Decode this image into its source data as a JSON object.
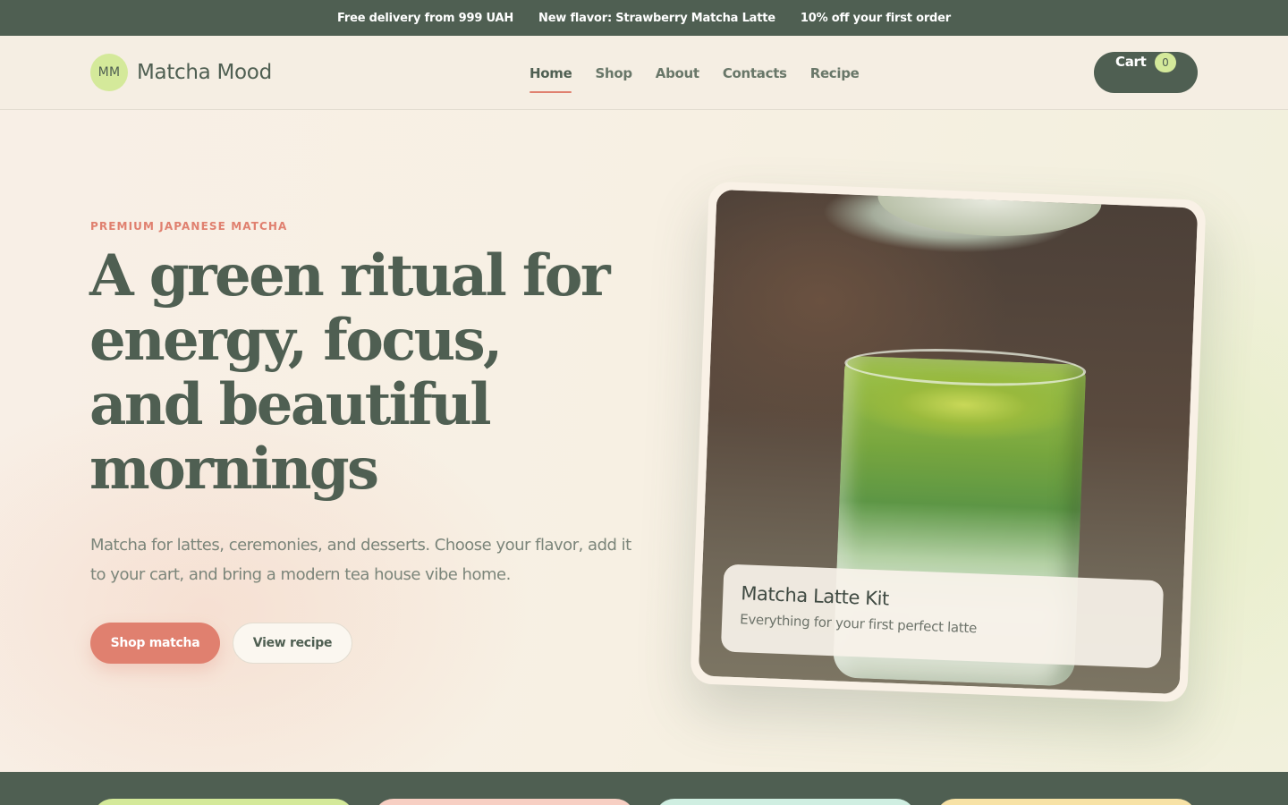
{
  "announcements": [
    "Free delivery from 999 UAH",
    "New flavor: Strawberry Matcha Latte",
    "10% off your first order"
  ],
  "brand": {
    "mark": "MM",
    "name": "Matcha Mood"
  },
  "nav": {
    "items": [
      "Home",
      "Shop",
      "About",
      "Contacts",
      "Recipe"
    ],
    "active": "Home"
  },
  "cart": {
    "label": "Cart",
    "count": "0"
  },
  "hero": {
    "eyebrow": "PREMIUM JAPANESE MATCHA",
    "headline_lines": [
      "A green ritual for",
      "energy, focus,",
      "and beautiful",
      "mornings"
    ],
    "subtext": "Matcha for lattes, ceremonies, and desserts. Choose your flavor, add it to your cart, and bring a modern tea house vibe home.",
    "primary_cta": "Shop matcha",
    "secondary_cta": "View recipe"
  },
  "product_card": {
    "title": "Matcha Latte Kit",
    "subtitle": "Everything for your first perfect latte"
  },
  "colors": {
    "brand_dark": "#4f5f52",
    "accent_coral": "#e0806f",
    "accent_lime": "#d4e99a",
    "background": "#f6efe4",
    "band_card_colors": [
      "#d4e99a",
      "#f7cfc3",
      "#cfeee1",
      "#f7e2a6"
    ]
  }
}
